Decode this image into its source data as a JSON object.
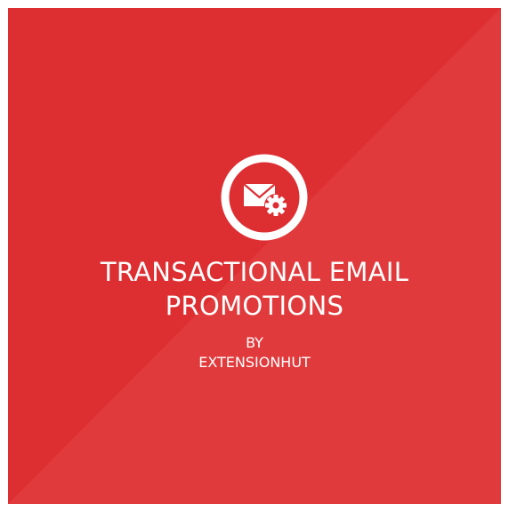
{
  "banner": {
    "title_line1": "TRANSACTIONAL EMAIL",
    "title_line2": "PROMOTIONS",
    "by": "BY",
    "vendor": "EXTENSIONHUT",
    "icon": "envelope-gear-icon"
  },
  "colors": {
    "background_dark": "#dd2e32",
    "background_light": "#e13a3c",
    "foreground": "#ffffff"
  }
}
